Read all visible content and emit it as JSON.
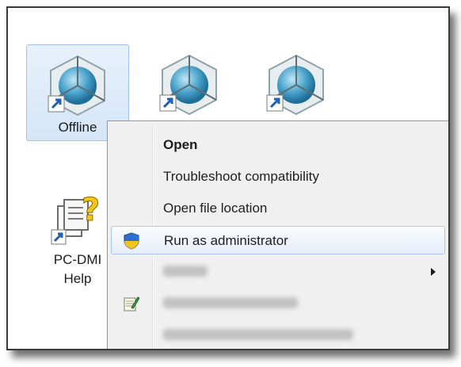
{
  "desktop": {
    "icons": [
      {
        "label": "Offline",
        "icon": "globe-cube-shortcut-icon",
        "selected": true
      },
      {
        "label": "",
        "icon": "globe-cube-shortcut-icon"
      },
      {
        "label": "",
        "icon": "globe-cube-shortcut-icon"
      },
      {
        "label": "PC-DMI\nHelp",
        "label_line1": "PC-DMI",
        "label_line2": "Help",
        "icon": "help-document-shortcut-icon"
      }
    ]
  },
  "context_menu": {
    "items": [
      {
        "label": "Open",
        "bold": true
      },
      {
        "label": "Troubleshoot compatibility"
      },
      {
        "label": "Open file location"
      },
      {
        "label": "Run as administrator",
        "icon": "uac-shield-icon",
        "highlighted": true
      },
      {
        "label": "",
        "blurred": true,
        "has_submenu": true
      },
      {
        "label": "",
        "blurred": true,
        "icon": "notepad-icon"
      },
      {
        "label": "",
        "blurred": true
      }
    ]
  },
  "colors": {
    "selection_bg": "#d5e6f8",
    "selection_border": "#9fc3e8",
    "menu_bg": "#f0f0f0",
    "menu_hover_border": "#a8c8ed"
  }
}
